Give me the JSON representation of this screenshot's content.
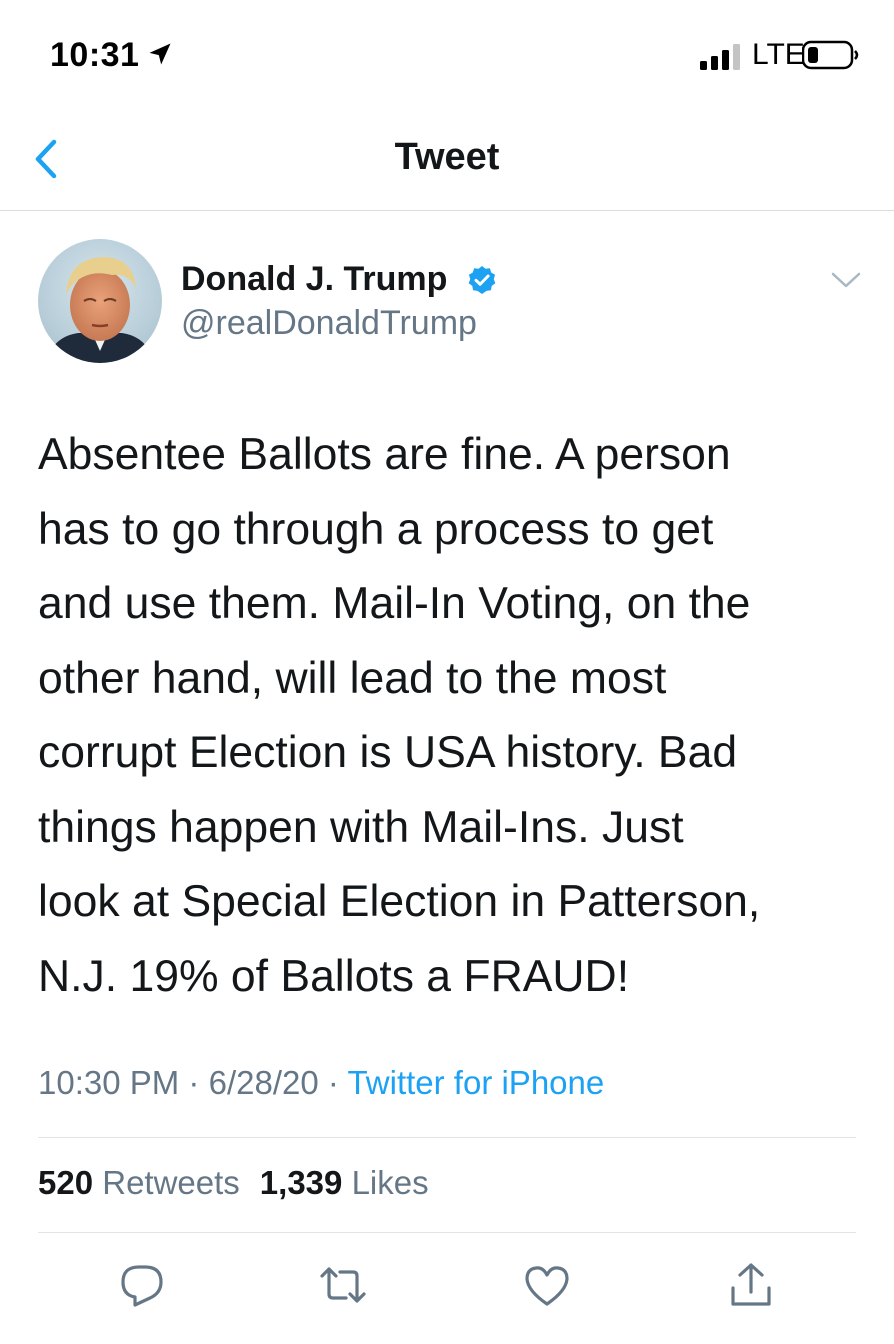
{
  "status_bar": {
    "time": "10:31",
    "network": "LTE"
  },
  "nav": {
    "title": "Tweet"
  },
  "tweet": {
    "display_name": "Donald J. Trump",
    "handle": "@realDonaldTrump",
    "text": "Absentee Ballots are fine. A person\nhas to go through a process to get\nand use them. Mail-In Voting, on the\nother hand, will lead to the most\ncorrupt Election is USA history. Bad\nthings happen with Mail-Ins. Just\nlook at Special Election in Patterson,\nN.J. 19% of Ballots a FRAUD!",
    "time": "10:30 PM",
    "date": "6/28/20",
    "separator": "·",
    "source": "Twitter for iPhone",
    "retweets_count": "520",
    "retweets_label": "Retweets",
    "likes_count": "1,339",
    "likes_label": "Likes"
  },
  "colors": {
    "accent": "#1da1f2",
    "secondary_text": "#657786",
    "primary_text": "#14171a",
    "divider": "#e1e5e8"
  },
  "icons": {
    "location": "location-arrow-icon",
    "signal": "cellular-signal-icon",
    "battery": "battery-low-icon",
    "back": "chevron-left-icon",
    "verified": "verified-badge-icon",
    "more": "chevron-down-icon",
    "reply": "reply-icon",
    "retweet": "retweet-icon",
    "like": "heart-icon",
    "share": "share-icon"
  }
}
